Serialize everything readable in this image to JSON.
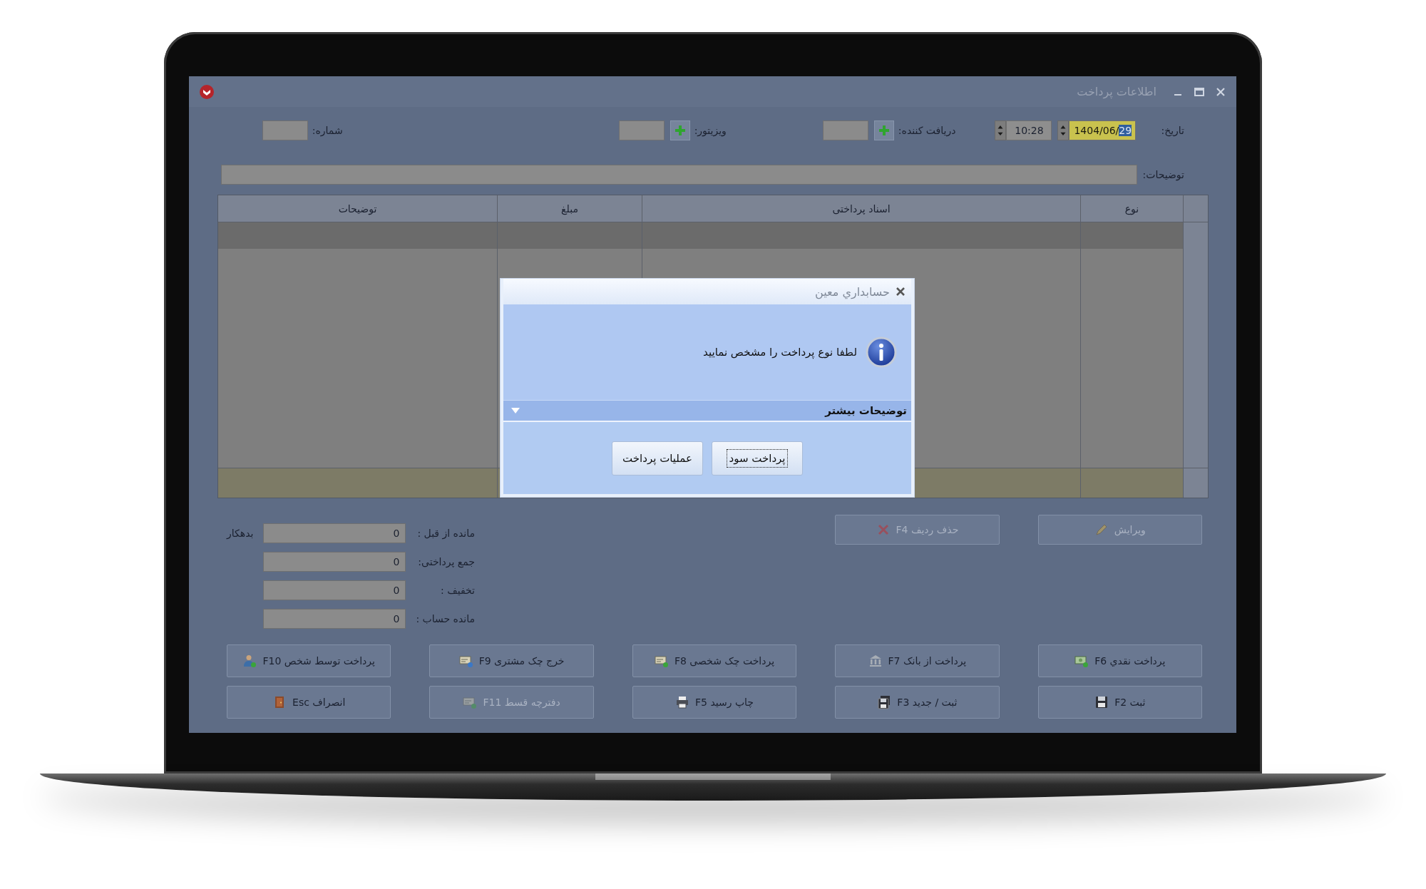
{
  "window": {
    "title": "اطلاعات پرداخت"
  },
  "header": {
    "date_label": "تاریخ:",
    "date": {
      "text": "1404/06/",
      "selected_text": "29"
    },
    "time": "10:28",
    "receiver_label": "دریافت کننده:",
    "visitor_label": "ویزیتور:",
    "number_label": "شماره:",
    "description_label": "توضیحات:"
  },
  "table": {
    "columns": [
      "نوع",
      "اسناد پرداختی",
      "مبلغ",
      "توضیحات"
    ]
  },
  "summary": {
    "balance_type": "بدهکار",
    "rows": [
      {
        "label": "مانده از قبل :",
        "value": "0"
      },
      {
        "label": "جمع پرداختی:",
        "value": "0"
      },
      {
        "label": "تخفیف :",
        "value": "0"
      },
      {
        "label": "مانده حساب :",
        "value": "0"
      }
    ]
  },
  "edit_buttons": [
    {
      "label": "ویرایش",
      "kind": "pencil",
      "disabled": true
    },
    {
      "label": "حذف ردیف F4",
      "kind": "delete",
      "disabled": true
    }
  ],
  "buttons": [
    {
      "label": "پرداخت نقدي F6",
      "kind": "cash",
      "disabled": false
    },
    {
      "label": "پرداخت از بانک F7",
      "kind": "bank",
      "disabled": false
    },
    {
      "label": "پرداخت چک شخصی F8",
      "kind": "cheque",
      "disabled": false
    },
    {
      "label": "خرج چک مشتری F9",
      "kind": "cheque-out",
      "disabled": false
    },
    {
      "label": "پرداخت توسط شخص F10",
      "kind": "person",
      "disabled": false
    },
    {
      "label": "ثبت F2",
      "kind": "save",
      "disabled": false
    },
    {
      "label": "ثبت / جدید F3",
      "kind": "save-new",
      "disabled": false
    },
    {
      "label": "چاپ رسید F5",
      "kind": "print",
      "disabled": false
    },
    {
      "label": "دفترچه قسط F11",
      "kind": "booklet",
      "disabled": true
    },
    {
      "label": "انصراف Esc",
      "kind": "exit",
      "disabled": false
    }
  ],
  "dialog": {
    "title": "حسابداري معين",
    "message": "لطفا نوع پرداخت را مشخص نمایید",
    "details_label": "توضیحات بیشتر",
    "details_expanded": false,
    "buttons": [
      {
        "label": "پرداخت سود",
        "focused": true
      },
      {
        "label": "عملیات پرداخت",
        "focused": false
      }
    ]
  }
}
